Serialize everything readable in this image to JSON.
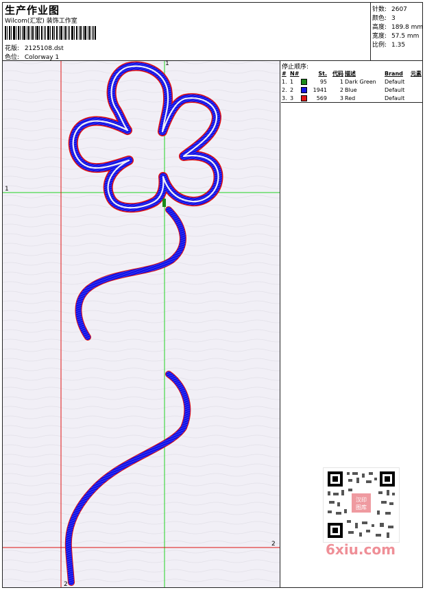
{
  "header": {
    "title": "生产作业图",
    "company": "Wilcom(汇宏) 装饰工作室",
    "design_label": "花版:",
    "design_value": "2125108.dst",
    "color_label": "色位:",
    "color_value": "Colorway 1"
  },
  "stats": [
    {
      "label": "针数:",
      "value": "2607"
    },
    {
      "label": "颜色:",
      "value": "3"
    },
    {
      "label": "高度:",
      "value": "189.8 mm"
    },
    {
      "label": "宽度:",
      "value": "57.5 mm"
    },
    {
      "label": "比例:",
      "value": "1.35"
    }
  ],
  "stop_sequence": {
    "title": "停止顺序:",
    "columns": [
      "#",
      "N#",
      "St.",
      "代码",
      "描述",
      "Brand",
      "元素"
    ],
    "rows": [
      {
        "idx": "1.",
        "n": "1",
        "color": "#1b8a1b",
        "stitches": "95",
        "code": "1",
        "desc": "Dark Green",
        "brand": "Default"
      },
      {
        "idx": "2.",
        "n": "2",
        "color": "#1616e0",
        "stitches": "1941",
        "code": "2",
        "desc": "Blue",
        "brand": "Default"
      },
      {
        "idx": "3.",
        "n": "3",
        "color": "#e01616",
        "stitches": "569",
        "code": "3",
        "desc": "Red",
        "brand": "Default"
      }
    ]
  },
  "guides": {
    "v1": "1",
    "h1": "1",
    "h2": "2",
    "v2": "2"
  },
  "watermark": {
    "text": "6xiu.com",
    "qr_center": "汉印图库"
  },
  "colors": {
    "embroidery": "#1010e6",
    "outline": "#e01010",
    "guide_green": "#21d321",
    "guide_red": "#e01010",
    "canvas": "#f1eff6"
  }
}
